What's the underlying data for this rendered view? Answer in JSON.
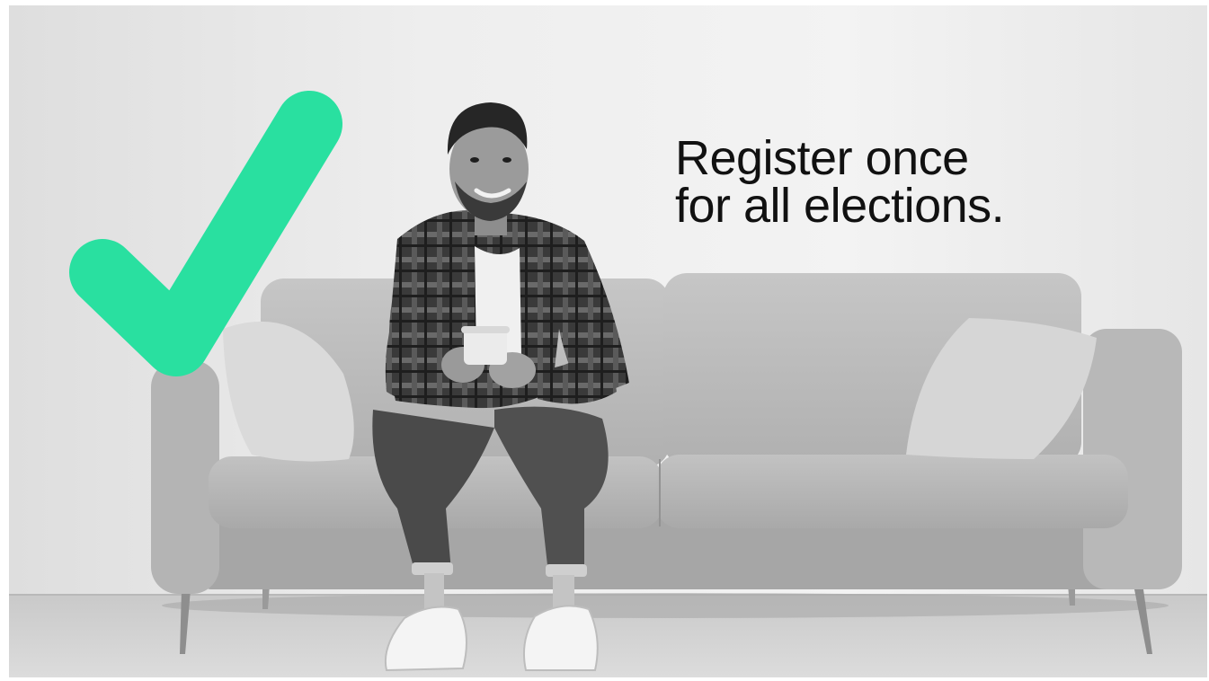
{
  "headline": {
    "line1": "Register once",
    "line2": "for all elections."
  },
  "icons": {
    "checkmark": "checkmark-icon"
  },
  "colors": {
    "checkmark": "#29e0a0",
    "headline_text": "#111111",
    "background_wall": "#eeeeee"
  }
}
